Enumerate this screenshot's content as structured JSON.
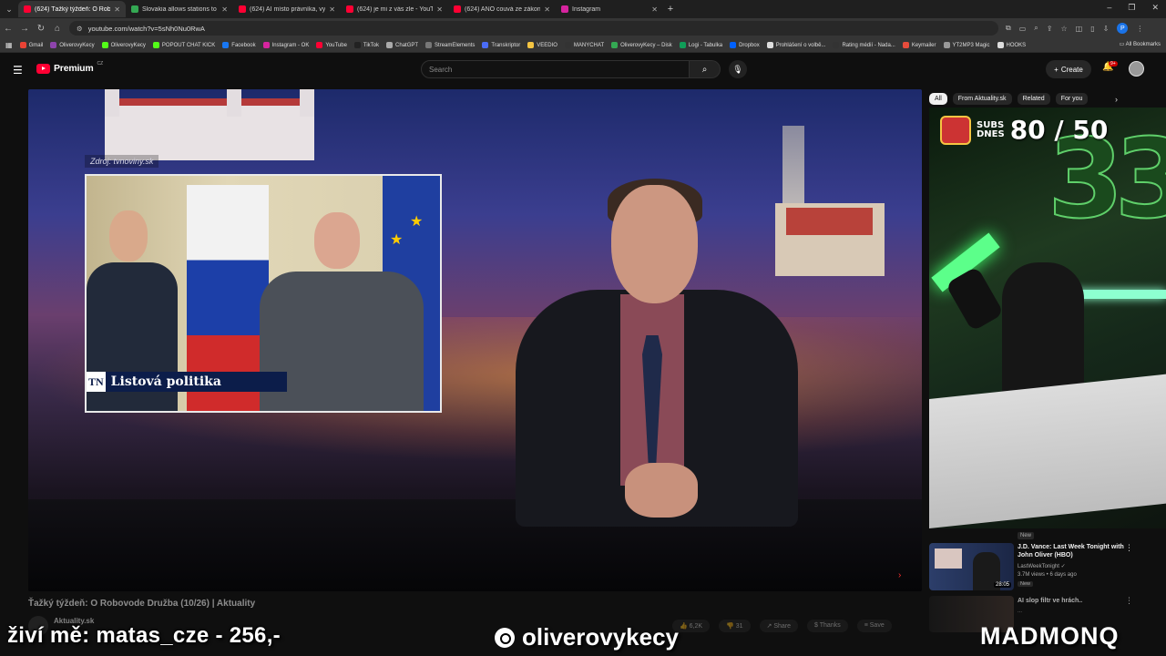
{
  "browser": {
    "tabs": [
      {
        "label": "(624) Ťažký týždeň: O Robo",
        "color": "#ff0033",
        "active": true
      },
      {
        "label": "Slovakia allows stations to set n",
        "color": "#34a853",
        "active": false
      },
      {
        "label": "(624) AI místo právníka, vyhoz",
        "color": "#ff0033",
        "active": false
      },
      {
        "label": "(624) je mi z vás zle - YouTube",
        "color": "#ff0033",
        "active": false
      },
      {
        "label": "(624) ANO couvá ze zákona o n",
        "color": "#ff0033",
        "active": false
      },
      {
        "label": "Instagram",
        "color": "#d6249f",
        "active": false
      }
    ],
    "new_tab": "+",
    "url": "youtube.com/watch?v=5sNh0Nu0RwA",
    "profile_initial": "P",
    "bookmarks": [
      {
        "label": "Gmail",
        "color": "#ea4335"
      },
      {
        "label": "OliverovyKecy",
        "color": "#8e44ad"
      },
      {
        "label": "OliverovyKecy",
        "color": "#53fc18"
      },
      {
        "label": "POPOUT CHAT KICK",
        "color": "#53fc18"
      },
      {
        "label": "Facebook",
        "color": "#1877f2"
      },
      {
        "label": "Instagram - OK",
        "color": "#d6249f"
      },
      {
        "label": "YouTube",
        "color": "#ff0033"
      },
      {
        "label": "TikTok",
        "color": "#222222"
      },
      {
        "label": "ChatGPT",
        "color": "#aaaaaa"
      },
      {
        "label": "StreamElements",
        "color": "#777777"
      },
      {
        "label": "Transkriptor",
        "color": "#4a6cf7"
      },
      {
        "label": "VEEDIO",
        "color": "#f5c542"
      },
      {
        "label": "MANYCHAT",
        "color": "#333333"
      },
      {
        "label": "OliverovyKecy – Disk",
        "color": "#34a853"
      },
      {
        "label": "Logi - Tabulka",
        "color": "#0f9d58"
      },
      {
        "label": "Dropbox",
        "color": "#0061ff"
      },
      {
        "label": "Prohlášení o volbě...",
        "color": "#dddddd"
      },
      {
        "label": "Rating médií - Nada...",
        "color": "#333333"
      },
      {
        "label": "Keymailer",
        "color": "#e74c3c"
      },
      {
        "label": "YT2MP3 Magic",
        "color": "#999999"
      },
      {
        "label": "HOOKS",
        "color": "#dddddd"
      }
    ],
    "all_bookmarks": "All Bookmarks"
  },
  "youtube": {
    "logo_text": "Premium",
    "country": "CZ",
    "search_placeholder": "Search",
    "create_label": "Create",
    "notif_badge": "9+"
  },
  "video": {
    "source_text": "Zdroj: tvnoviny.sk",
    "tn_logo": "TN",
    "lower_third": "Listová politika",
    "title": "Ťažký týždeň: O Robovode Družba (10/26) | Aktuality",
    "channel": "Aktuality.sk",
    "actions": [
      "6,2K",
      "31",
      "Share",
      "Thanks",
      "Save"
    ]
  },
  "sidebar": {
    "chips": [
      "All",
      "From Aktuality.sk",
      "Related",
      "For you"
    ],
    "webcam": {
      "subs_label_1": "SUBS",
      "subs_label_2": "DNES",
      "subs_count": "80 / 50"
    },
    "new_badge": "New",
    "recommendation": {
      "title": "J.D. Vance: Last Week Tonight with John Oliver (HBO)",
      "channel": "LastWeekTonight ✓",
      "meta": "3.7M views • 6 days ago",
      "duration": "28:05",
      "badge": "New"
    },
    "recommendation2": {
      "title": "AI slop filtr ve hrách..",
      "meta": "..."
    }
  },
  "overlay": {
    "left": "živí mě: matas_cze - 256,-",
    "center": "oliverovykecy",
    "right": "MADMONQ"
  }
}
